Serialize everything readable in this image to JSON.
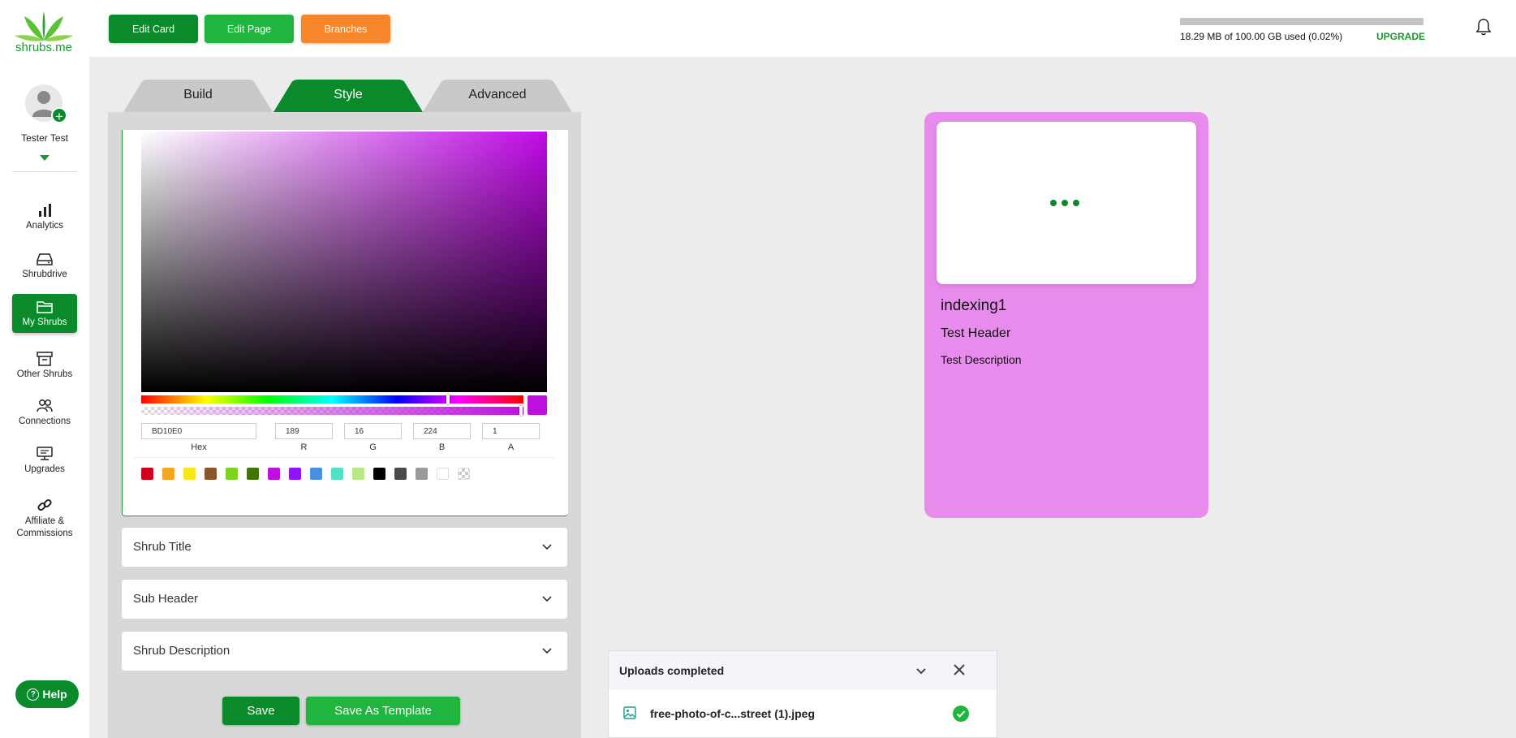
{
  "sidebar": {
    "logo_text": "shrubs.me",
    "user_name": "Tester Test",
    "nav": [
      {
        "label": "Analytics",
        "icon": "bar-chart-icon"
      },
      {
        "label": "Shrubdrive",
        "icon": "drive-icon"
      },
      {
        "label": "My Shrubs",
        "icon": "folder-icon",
        "active": true
      },
      {
        "label": "Other Shrubs",
        "icon": "archive-icon"
      },
      {
        "label": "Connections",
        "icon": "people-icon"
      },
      {
        "label": "Upgrades",
        "icon": "monitor-icon"
      },
      {
        "label": "Affiliate & Commissions",
        "icon": "link-icon"
      }
    ],
    "help_label": "Help"
  },
  "toolbar": {
    "edit_card": "Edit Card",
    "edit_page": "Edit Page",
    "branches": "Branches"
  },
  "storage": {
    "text": "18.29 MB of 100.00 GB used (0.02%)",
    "percent": 0.02,
    "upgrade_label": "UPGRADE"
  },
  "tabs": {
    "build": "Build",
    "style": "Style",
    "advanced": "Advanced",
    "active": "Style"
  },
  "color_picker": {
    "hex": "BD10E0",
    "r": "189",
    "g": "16",
    "b": "224",
    "a": "1",
    "labels": {
      "hex": "Hex",
      "r": "R",
      "g": "G",
      "b": "B",
      "a": "A"
    },
    "swatches": [
      "#d0021b",
      "#f5a623",
      "#f8e71c",
      "#8b572a",
      "#7ed321",
      "#417505",
      "#bd10e0",
      "#9013fe",
      "#4a90e2",
      "#50e3c2",
      "#b8e986",
      "#000000",
      "#4a4a4a",
      "#9b9b9b",
      "#ffffff",
      "transparent"
    ]
  },
  "sections": {
    "shrub_title": "Shrub Title",
    "sub_header": "Sub Header",
    "shrub_description": "Shrub Description"
  },
  "actions": {
    "save": "Save",
    "save_as_template": "Save As Template"
  },
  "preview": {
    "background": "#e78cec",
    "title": "indexing1",
    "header": "Test Header",
    "description": "Test Description"
  },
  "uploads": {
    "title": "Uploads completed",
    "file_name": "free-photo-of-c...street (1).jpeg"
  },
  "colors": {
    "primary": "#0b8a2c",
    "bright_green": "#1fb53f",
    "orange": "#f7862a"
  }
}
